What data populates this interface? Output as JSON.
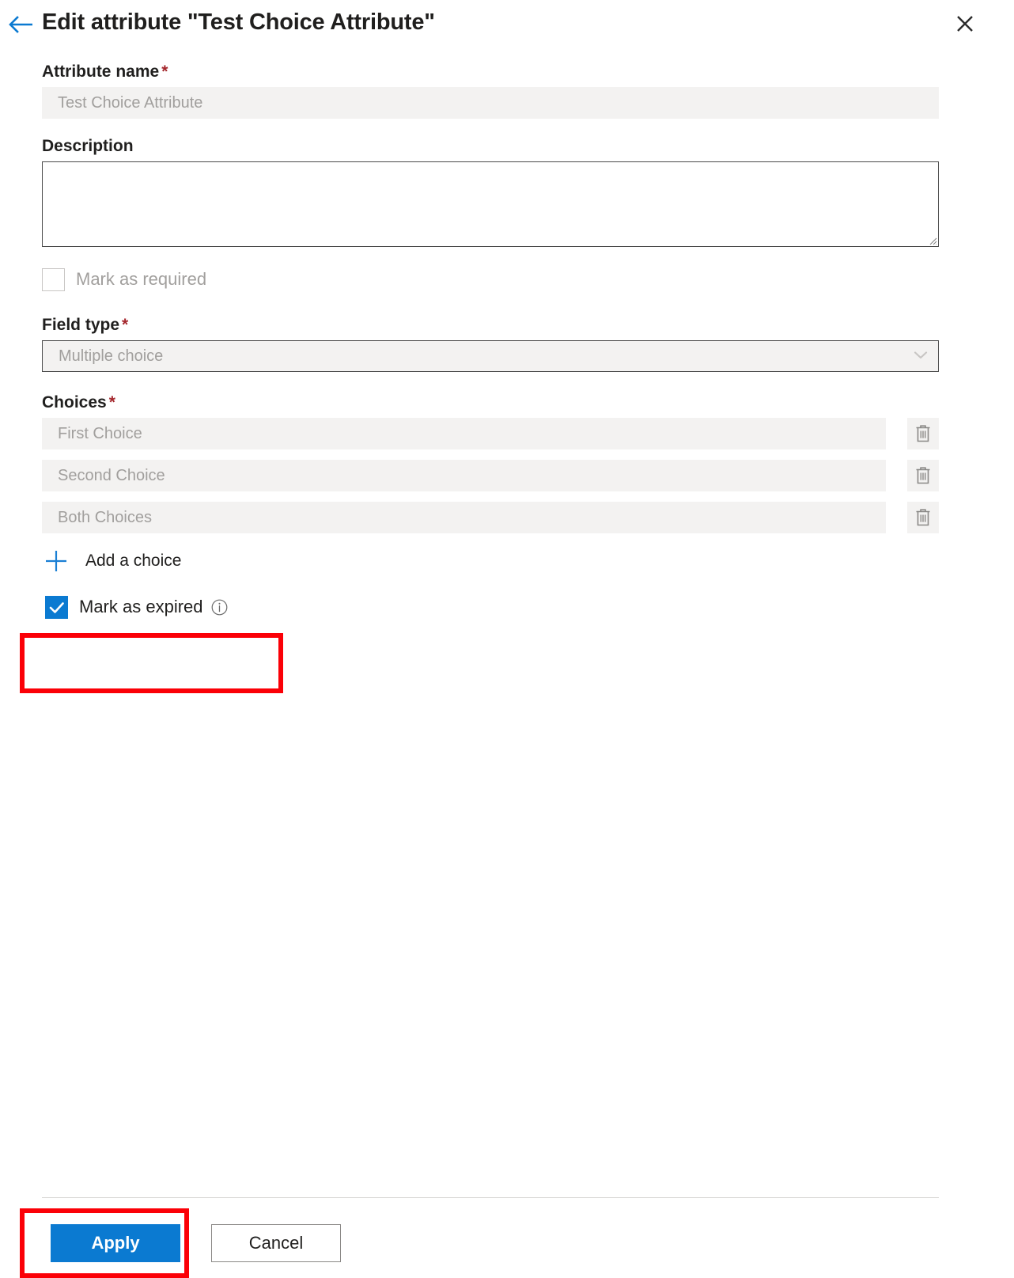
{
  "header": {
    "back_icon": "arrow-left-icon",
    "title": "Edit attribute \"Test Choice Attribute\"",
    "close_icon": "close-icon",
    "accent_color": "#0b7ad1"
  },
  "form": {
    "attribute_name": {
      "label": "Attribute name",
      "required_marker": "*",
      "value": "",
      "placeholder": "Test Choice Attribute",
      "disabled": true
    },
    "description": {
      "label": "Description",
      "value": "",
      "placeholder": ""
    },
    "mark_as_required": {
      "label": "Mark as required",
      "checked": false,
      "disabled": true
    },
    "field_type": {
      "label": "Field type",
      "required_marker": "*",
      "selected": "Multiple choice",
      "disabled": true,
      "chevron_icon": "chevron-down-icon"
    },
    "choices": {
      "label": "Choices",
      "required_marker": "*",
      "items": [
        {
          "placeholder": "First Choice",
          "value": "",
          "delete_icon": "trash-icon"
        },
        {
          "placeholder": "Second Choice",
          "value": "",
          "delete_icon": "trash-icon"
        },
        {
          "placeholder": "Both Choices",
          "value": "",
          "delete_icon": "trash-icon"
        }
      ],
      "add_label": "Add a choice",
      "add_icon": "plus-icon"
    },
    "mark_as_expired": {
      "label": "Mark as expired",
      "checked": true,
      "info_icon": "info-icon",
      "check_color": "#0b7ad1"
    }
  },
  "footer": {
    "apply_label": "Apply",
    "cancel_label": "Cancel"
  },
  "annotations": {
    "highlight_color": "#fb0007",
    "boxes": [
      "mark-as-expired",
      "apply-button"
    ]
  }
}
